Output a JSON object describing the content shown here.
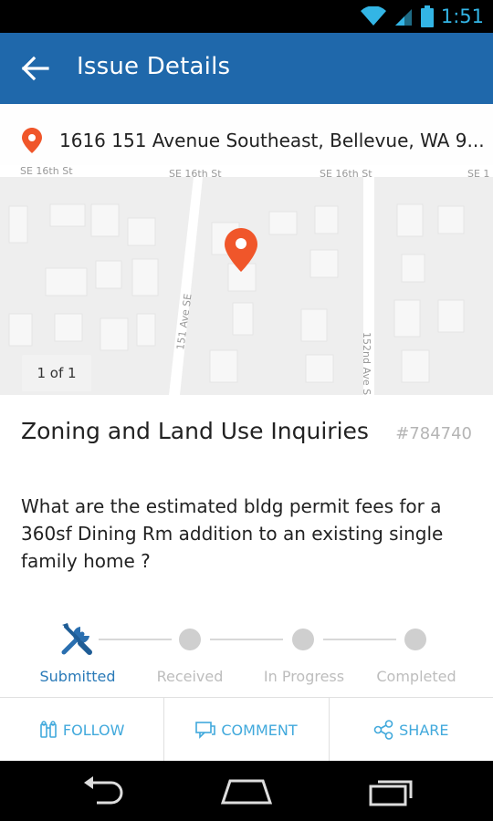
{
  "status_bar": {
    "time": "1:51"
  },
  "app_bar": {
    "title": "Issue Details"
  },
  "location": {
    "address": "1616 151 Avenue Southeast, Bellevue, WA 9...",
    "photo_counter": "1 of 1",
    "street_labels": {
      "se16th_a": "SE 16th St",
      "se16th_b": "SE 16th St",
      "se16th_c": "SE 16th St",
      "se16th_d": "SE 1",
      "ave151": "151 Ave SE",
      "ave152": "152nd Ave S"
    }
  },
  "issue": {
    "title": "Zoning and Land Use Inquiries",
    "number": "#784740",
    "description": "What are the estimated bldg permit fees for a 360sf Dining Rm addition to an existing single family home ?"
  },
  "progress": {
    "steps": [
      "Submitted",
      "Received",
      "In Progress",
      "Completed"
    ],
    "current": "Submitted"
  },
  "actions": {
    "follow": "FOLLOW",
    "comment": "COMMENT",
    "share": "SHARE"
  },
  "colors": {
    "app_bar": "#1f68ab",
    "accent": "#41a9dc",
    "pin": "#f0562a"
  },
  "icons": [
    "wifi-icon",
    "signal-icon",
    "battery-icon",
    "back-arrow-icon",
    "location-pin-icon",
    "map-pin-icon",
    "wrench-screwdriver-icon",
    "follow-icon",
    "comment-icon",
    "share-icon",
    "nav-back-icon",
    "nav-home-icon",
    "nav-recent-icon"
  ]
}
